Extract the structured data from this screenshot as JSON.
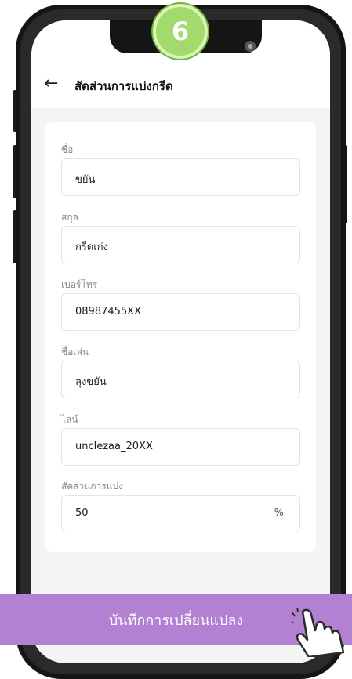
{
  "step_badge": "6",
  "header": {
    "title": "สัดส่วนการแบ่งกรีด"
  },
  "form": {
    "first_name": {
      "label": "ชื่อ",
      "value": "ขยัน"
    },
    "last_name": {
      "label": "สกุล",
      "value": "กรีดเก่ง"
    },
    "phone": {
      "label": "เบอร์โทร",
      "value": "08987455XX"
    },
    "nickname": {
      "label": "ชื่อเล่น",
      "value": "ลุงขยัน"
    },
    "line": {
      "label": "ไลน์",
      "value": "unclezaa_20XX"
    },
    "share": {
      "label": "สัดส่วนการแบ่ง",
      "value": "50",
      "unit": "%"
    }
  },
  "save_button": {
    "label": "บันทึกการเปลี่ยนแปลง",
    "color": "#b281d1"
  },
  "icons": [
    "back-arrow-icon",
    "camera-icon",
    "pointing-hand-icon"
  ],
  "colors": {
    "badge": "#a2db6c",
    "accent": "#b281d1"
  }
}
